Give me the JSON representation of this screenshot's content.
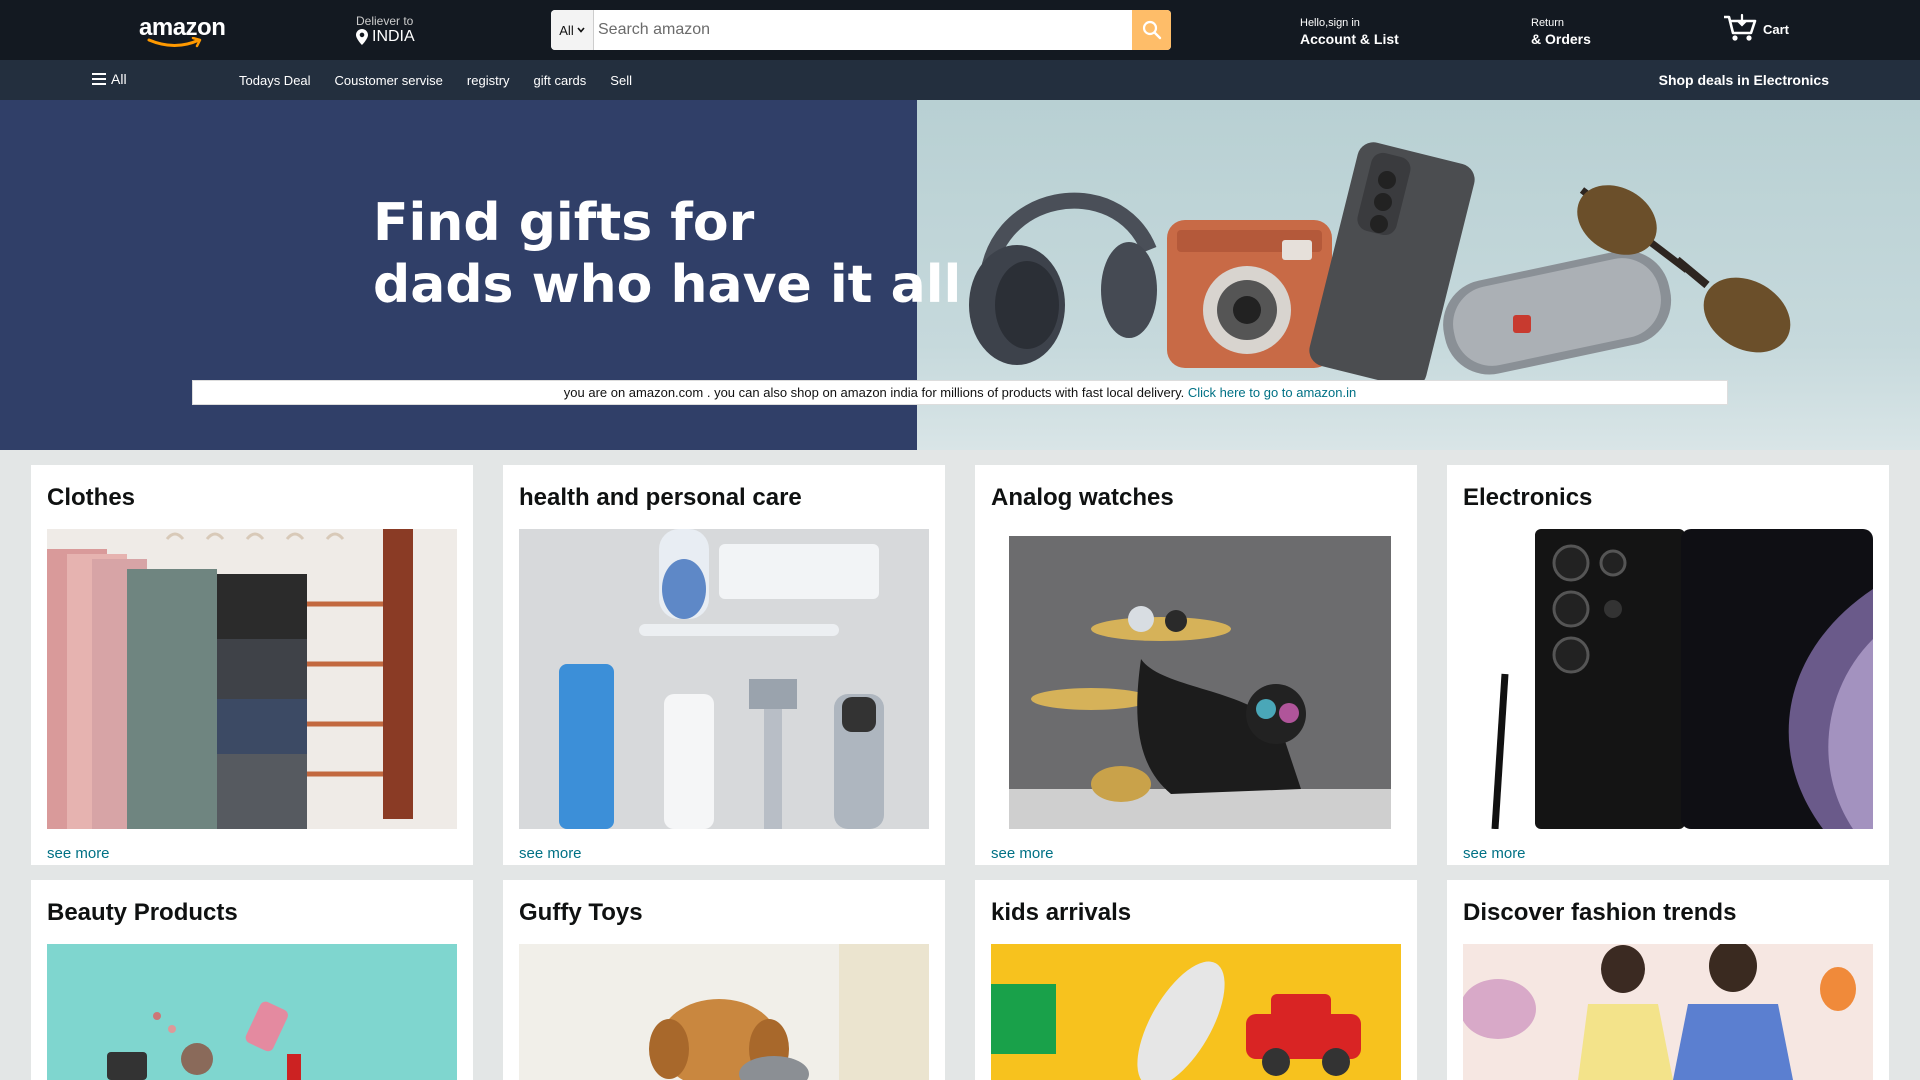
{
  "header": {
    "logo_text": "amazon",
    "deliver_small": "Deliever to",
    "deliver_location": "INDIA",
    "search_category": "All",
    "search_placeholder": "Search amazon",
    "account_small": "Hello,sign in",
    "account_big": "Account & List",
    "returns_small": "Return",
    "returns_big": "& Orders",
    "cart_label": "Cart"
  },
  "subnav": {
    "all_label": "All",
    "items": [
      "Todays Deal",
      "Coustomer servise",
      "registry",
      "gift cards",
      "Sell"
    ],
    "deals_label": "Shop deals in Electronics"
  },
  "hero": {
    "title_line1": "Find gifts for",
    "title_line2": "dads who have it all",
    "notice_text": "you are on amazon.com . you can also shop on amazon india for millions of products with fast local delivery.",
    "notice_link": "Click here to go to amazon.in"
  },
  "cards": [
    {
      "title": "Clothes",
      "link": "see more"
    },
    {
      "title": "health and personal care",
      "link": "see more"
    },
    {
      "title": "Analog watches",
      "link": "see more"
    },
    {
      "title": "Electronics",
      "link": "see more"
    },
    {
      "title": "Beauty Products",
      "link": ""
    },
    {
      "title": "Guffy Toys",
      "link": ""
    },
    {
      "title": "kids arrivals",
      "link": ""
    },
    {
      "title": "Discover fashion trends",
      "link": ""
    }
  ],
  "colors": {
    "nav_bg": "#131921",
    "subnav_bg": "#232f3e",
    "search_btn": "#febd69",
    "page_bg": "#e3e6e6",
    "link": "#007185",
    "hero_left": "#303f68"
  }
}
